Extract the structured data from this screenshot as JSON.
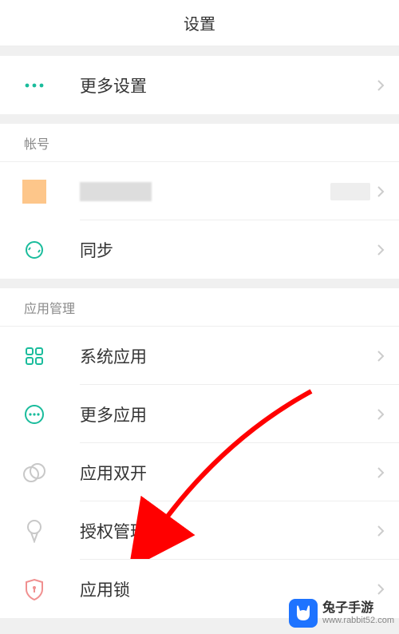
{
  "header": {
    "title": "设置"
  },
  "section_top": {
    "more_settings": {
      "label": "更多设置"
    }
  },
  "section_account": {
    "header": "帐号",
    "account_row": {
      "label": ""
    },
    "sync": {
      "label": "同步"
    }
  },
  "section_apps": {
    "header": "应用管理",
    "system_apps": {
      "label": "系统应用"
    },
    "more_apps": {
      "label": "更多应用"
    },
    "dual_apps": {
      "label": "应用双开"
    },
    "permissions": {
      "label": "授权管理"
    },
    "app_lock": {
      "label": "应用锁"
    }
  },
  "watermark": {
    "title": "兔子手游",
    "url": "www.rabbit52.com"
  }
}
